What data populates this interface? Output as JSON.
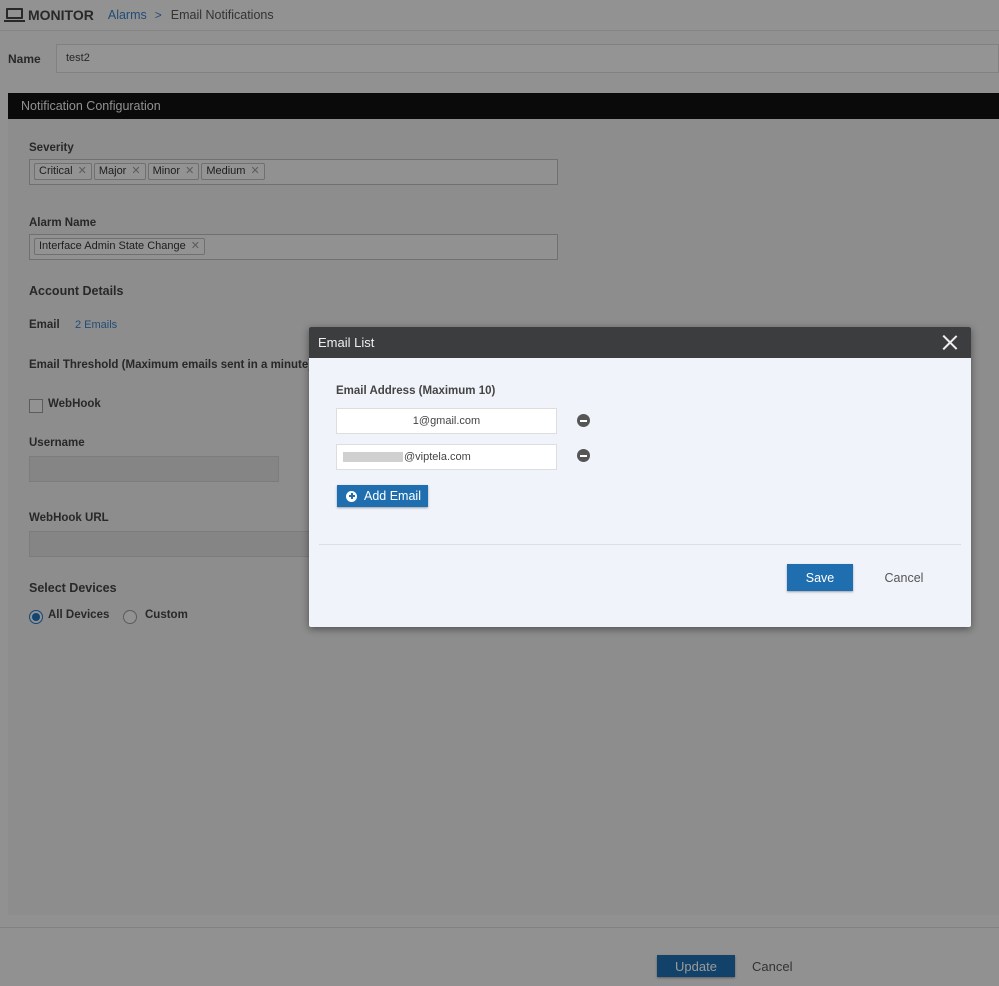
{
  "header": {
    "icon": "monitor-icon",
    "app_title": "MONITOR",
    "breadcrumb": {
      "link": "Alarms",
      "separator": ">",
      "current": "Email Notifications"
    }
  },
  "name_field": {
    "label": "Name",
    "value": "test2"
  },
  "section": {
    "title": "Notification Configuration",
    "severity": {
      "label": "Severity",
      "tags": [
        "Critical",
        "Major",
        "Minor",
        "Medium"
      ]
    },
    "alarm_name": {
      "label": "Alarm Name",
      "tags": [
        "Interface Admin State Change"
      ]
    },
    "account_details": "Account Details",
    "email": {
      "label": "Email",
      "link": "2 Emails"
    },
    "email_threshold_label": "Email Threshold (Maximum emails sent in a minute)",
    "webhook": {
      "label": "WebHook",
      "checked": false
    },
    "username": {
      "label": "Username",
      "value": ""
    },
    "webhook_url": {
      "label": "WebHook URL",
      "value": ""
    },
    "select_devices": {
      "label": "Select Devices",
      "options": [
        {
          "label": "All Devices",
          "selected": true
        },
        {
          "label": "Custom",
          "selected": false
        }
      ]
    }
  },
  "footer": {
    "update_label": "Update",
    "cancel_label": "Cancel"
  },
  "modal": {
    "title": "Email List",
    "field_label": "Email Address (Maximum 10)",
    "emails": [
      "1@gmail.com",
      "@viptela.com"
    ],
    "add_label": "Add Email",
    "save_label": "Save",
    "cancel_label": "Cancel"
  },
  "colors": {
    "primary": "#1f6fb0",
    "link": "#3a7fc4",
    "header_bar": "#111111",
    "modal_header": "#3c3d3f"
  }
}
